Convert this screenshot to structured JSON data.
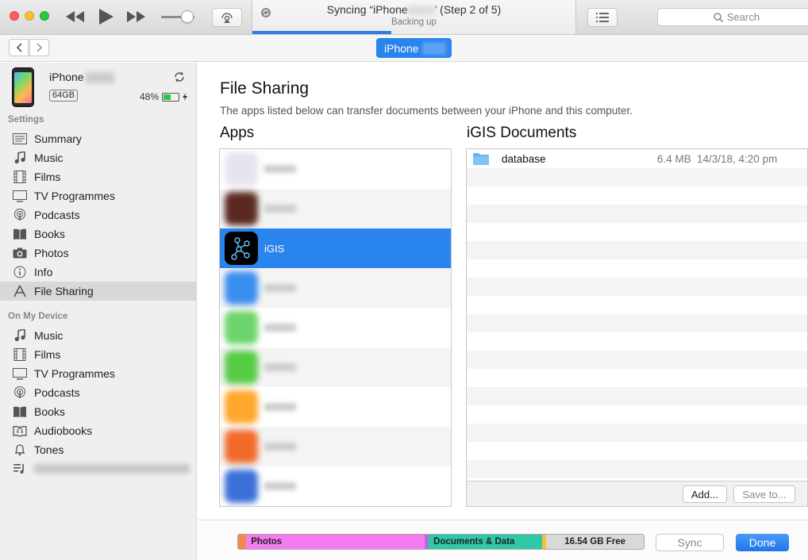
{
  "titlebar": {
    "status_title": "Syncing “iPhone",
    "status_title_tail": "’ (Step 2 of 5)",
    "status_subtitle": "Backing up",
    "sync_progress": 0.43,
    "search_placeholder": "Search"
  },
  "nav": {
    "device_pill_label": "iPhone"
  },
  "device": {
    "name": "iPhone",
    "capacity": "64GB",
    "battery": "48%",
    "battery_level": 0.48
  },
  "sidebar": {
    "settings_heading": "Settings",
    "settings_items": [
      {
        "label": "Summary",
        "icon": "summary-icon"
      },
      {
        "label": "Music",
        "icon": "music-note-icon"
      },
      {
        "label": "Films",
        "icon": "film-icon"
      },
      {
        "label": "TV Programmes",
        "icon": "tv-icon"
      },
      {
        "label": "Podcasts",
        "icon": "podcast-icon"
      },
      {
        "label": "Books",
        "icon": "book-icon"
      },
      {
        "label": "Photos",
        "icon": "camera-icon"
      },
      {
        "label": "Info",
        "icon": "info-icon"
      },
      {
        "label": "File Sharing",
        "icon": "apps-icon",
        "selected": true
      }
    ],
    "device_heading": "On My Device",
    "device_items": [
      {
        "label": "Music",
        "icon": "music-note-icon"
      },
      {
        "label": "Films",
        "icon": "film-icon"
      },
      {
        "label": "TV Programmes",
        "icon": "tv-icon"
      },
      {
        "label": "Podcasts",
        "icon": "podcast-icon"
      },
      {
        "label": "Books",
        "icon": "book-icon"
      },
      {
        "label": "Audiobooks",
        "icon": "audiobook-icon"
      },
      {
        "label": "Tones",
        "icon": "bell-icon"
      }
    ]
  },
  "file_sharing": {
    "title": "File Sharing",
    "description": "The apps listed below can transfer documents between your iPhone and this computer.",
    "apps_heading": "Apps",
    "docs_heading": "iGIS Documents",
    "apps": [
      {
        "name": "",
        "blurred": true,
        "color": "#e8e3f0"
      },
      {
        "name": "",
        "blurred": true,
        "color": "#5a2a22"
      },
      {
        "name": "iGIS",
        "blurred": false,
        "selected": true,
        "color": "#000000"
      },
      {
        "name": "",
        "blurred": true,
        "color": "#3a8ef0"
      },
      {
        "name": "",
        "blurred": true,
        "color": "#6cd46a"
      },
      {
        "name": "",
        "blurred": true,
        "color": "#55cc44"
      },
      {
        "name": "",
        "blurred": true,
        "color": "#ffa62b"
      },
      {
        "name": "",
        "blurred": true,
        "color": "#f26a2a"
      },
      {
        "name": "",
        "blurred": true,
        "color": "#3b6fd8"
      }
    ],
    "documents": [
      {
        "name": "database",
        "size": "6.4 MB",
        "date": "14/3/18, 4:20 pm"
      }
    ],
    "add_label": "Add...",
    "save_label": "Save to..."
  },
  "capacity_bar": {
    "segments": [
      {
        "label": "",
        "color": "#f08a4b",
        "fraction": 0.02
      },
      {
        "label": "Photos",
        "color": "#f57cf0",
        "fraction": 0.44
      },
      {
        "label": "",
        "color": "#b86be0",
        "fraction": 0.01
      },
      {
        "label": "Documents & Data",
        "color": "#2fc9a8",
        "fraction": 0.28
      },
      {
        "label": "",
        "color": "#f2c233",
        "fraction": 0.01
      },
      {
        "label": "16.54 GB Free",
        "color": "#d9d9d9",
        "fraction": 0.24
      }
    ]
  },
  "footer": {
    "sync_label": "Sync",
    "done_label": "Done"
  },
  "colors": {
    "accent": "#2a84ed"
  }
}
